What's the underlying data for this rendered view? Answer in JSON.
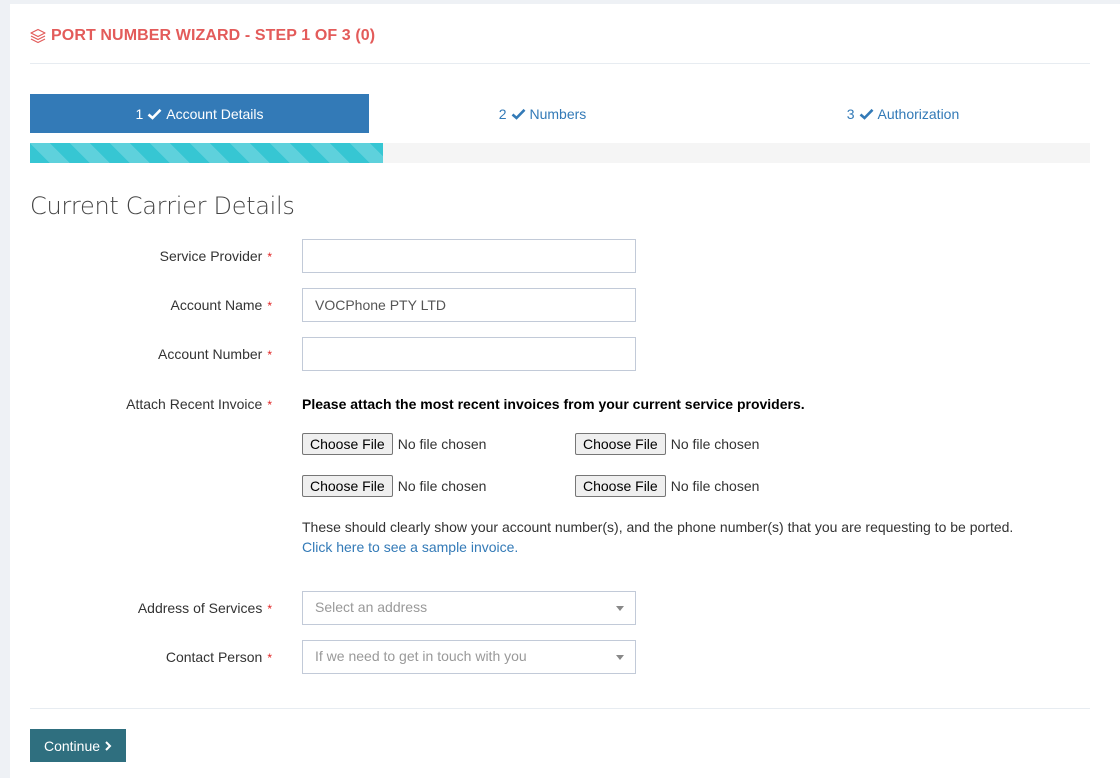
{
  "header": {
    "title": "PORT NUMBER WIZARD - STEP 1 OF 3 (0)",
    "icon": "layers-icon",
    "accent_color": "#e35b5a"
  },
  "steps": [
    {
      "num": "1",
      "label": "Account Details",
      "active": true
    },
    {
      "num": "2",
      "label": "Numbers",
      "active": false
    },
    {
      "num": "3",
      "label": "Authorization",
      "active": false
    }
  ],
  "progress": {
    "percent": 33.3
  },
  "section_title": "Current Carrier Details",
  "form": {
    "service_provider": {
      "label": "Service Provider",
      "value": ""
    },
    "account_name": {
      "label": "Account Name",
      "value": "VOCPhone PTY LTD"
    },
    "account_number": {
      "label": "Account Number",
      "value": ""
    },
    "invoice": {
      "label": "Attach Recent Invoice",
      "instruction": "Please attach the most recent invoices from your current service providers.",
      "button_label": "Choose File",
      "status": "No file chosen",
      "note": "These should clearly show your account number(s), and the phone number(s) that you are requesting to be ported.",
      "link": "Click here to see a sample invoice."
    },
    "address": {
      "label": "Address of Services",
      "placeholder": "Select an address"
    },
    "contact": {
      "label": "Contact Person",
      "placeholder": "If we need to get in touch with you"
    },
    "required_mark": "*"
  },
  "continue_label": "Continue"
}
